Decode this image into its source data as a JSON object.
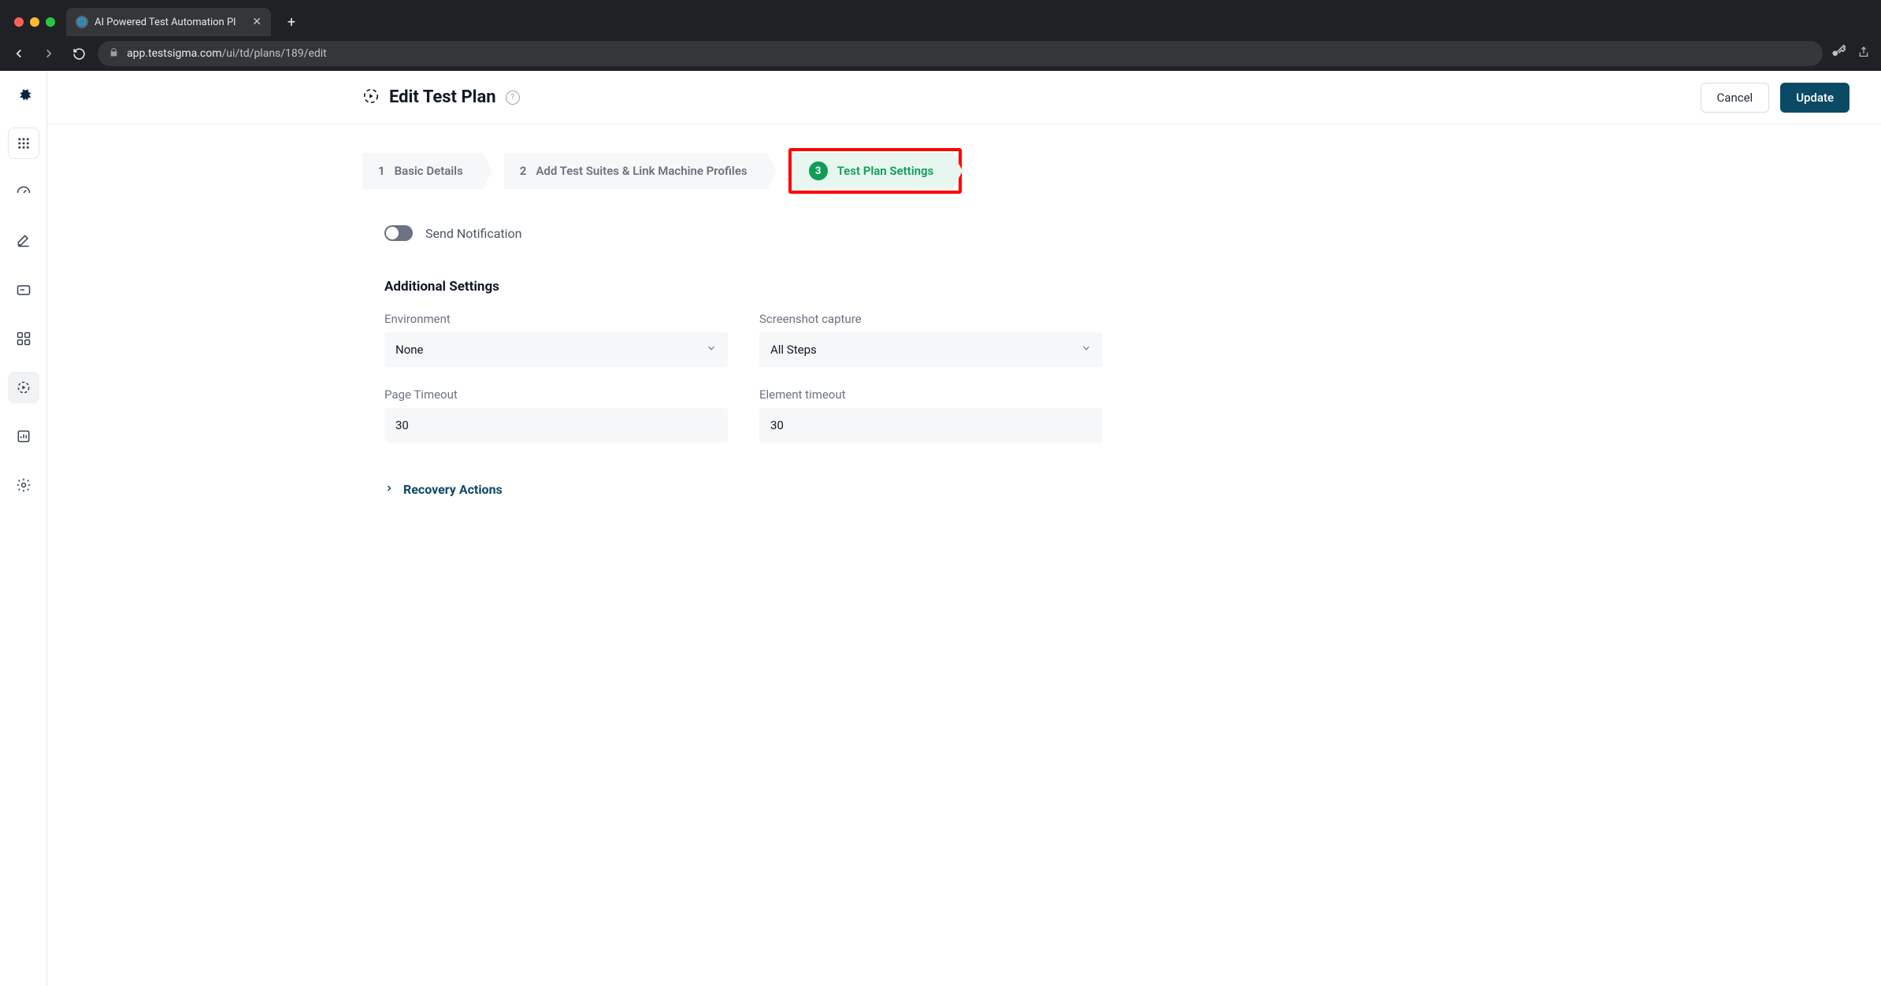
{
  "browser": {
    "tab_title": "AI Powered Test Automation Pl",
    "url_host": "app.testsigma.com",
    "url_path": "/ui/td/plans/189/edit"
  },
  "header": {
    "title": "Edit Test Plan",
    "cancel": "Cancel",
    "update": "Update"
  },
  "stepper": {
    "step1": {
      "num": "1",
      "label": "Basic Details"
    },
    "step2": {
      "num": "2",
      "label": "Add Test Suites & Link Machine Profiles"
    },
    "step3": {
      "num": "3",
      "label": "Test Plan Settings"
    }
  },
  "form": {
    "send_notification_label": "Send Notification",
    "section_title": "Additional Settings",
    "environment": {
      "label": "Environment",
      "value": "None"
    },
    "screenshot": {
      "label": "Screenshot capture",
      "value": "All Steps"
    },
    "page_timeout": {
      "label": "Page Timeout",
      "value": "30"
    },
    "element_timeout": {
      "label": "Element timeout",
      "value": "30"
    },
    "recovery_actions": "Recovery Actions"
  }
}
